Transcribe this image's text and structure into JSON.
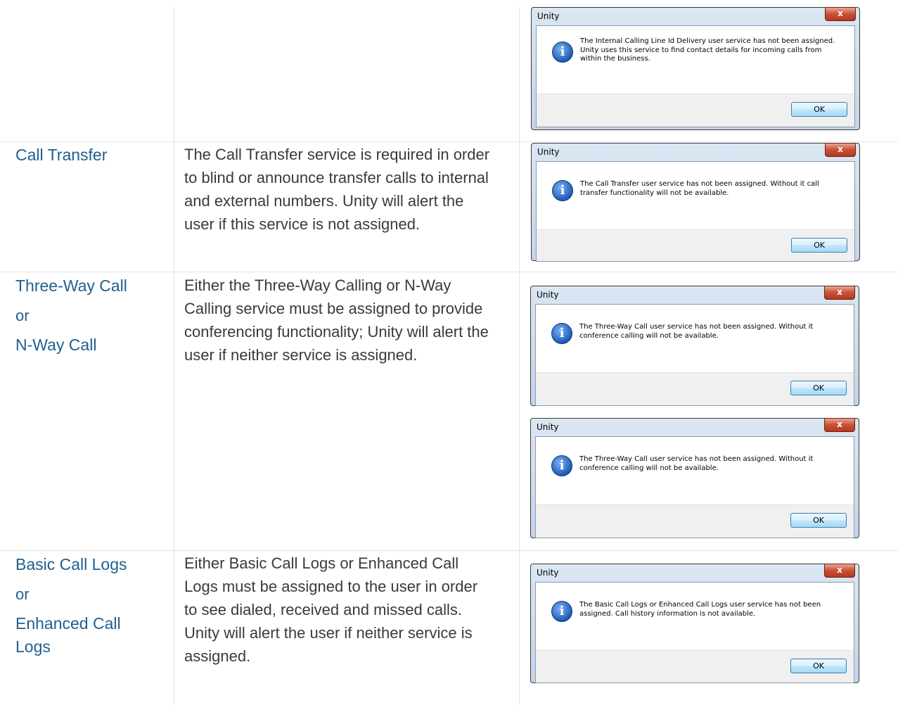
{
  "rows": {
    "internal_clid": {
      "dialog": {
        "title": "Unity",
        "close": "x",
        "message": "The Internal Calling Line Id Delivery user service has not been assigned. Unity uses this service to find contact details for incoming calls from within the business.",
        "ok": "OK"
      }
    },
    "call_transfer": {
      "service": "Call Transfer",
      "description": "The Call Transfer service is required in order to blind or announce transfer calls to internal and external numbers.  Unity will alert the user if this service is not assigned.",
      "dialog": {
        "title": "Unity",
        "close": "x",
        "message": "The Call Transfer user service has not been assigned.  Without it call transfer functionality will not be available.",
        "ok": "OK"
      }
    },
    "conference": {
      "service_1": "Three-Way Call",
      "or": "or",
      "service_2": "N-Way Call",
      "description": "Either the Three-Way Calling or N-Way Calling service must be assigned to provide conferencing functionality; Unity will alert the user if neither service is assigned.",
      "dialog_1": {
        "title": "Unity",
        "close": "x",
        "message": "The Three-Way Call user service has not been assigned.  Without it conference calling will not be available.",
        "ok": "OK"
      },
      "dialog_2": {
        "title": "Unity",
        "close": "x",
        "message": "The Three-Way Call user service has not been assigned.  Without it conference calling will not be available.",
        "ok": "OK"
      }
    },
    "call_logs": {
      "service_1": "Basic Call Logs",
      "or": "or",
      "service_2": "Enhanced Call Logs",
      "description": "Either Basic Call Logs or Enhanced Call Logs must be assigned to the user in order to see dialed, received and missed calls.  Unity will alert the user if neither service is assigned.",
      "dialog": {
        "title": "Unity",
        "close": "x",
        "message": "The Basic Call Logs or Enhanced Call Logs user service has not been assigned.  Call history information is not available.",
        "ok": "OK"
      }
    }
  }
}
